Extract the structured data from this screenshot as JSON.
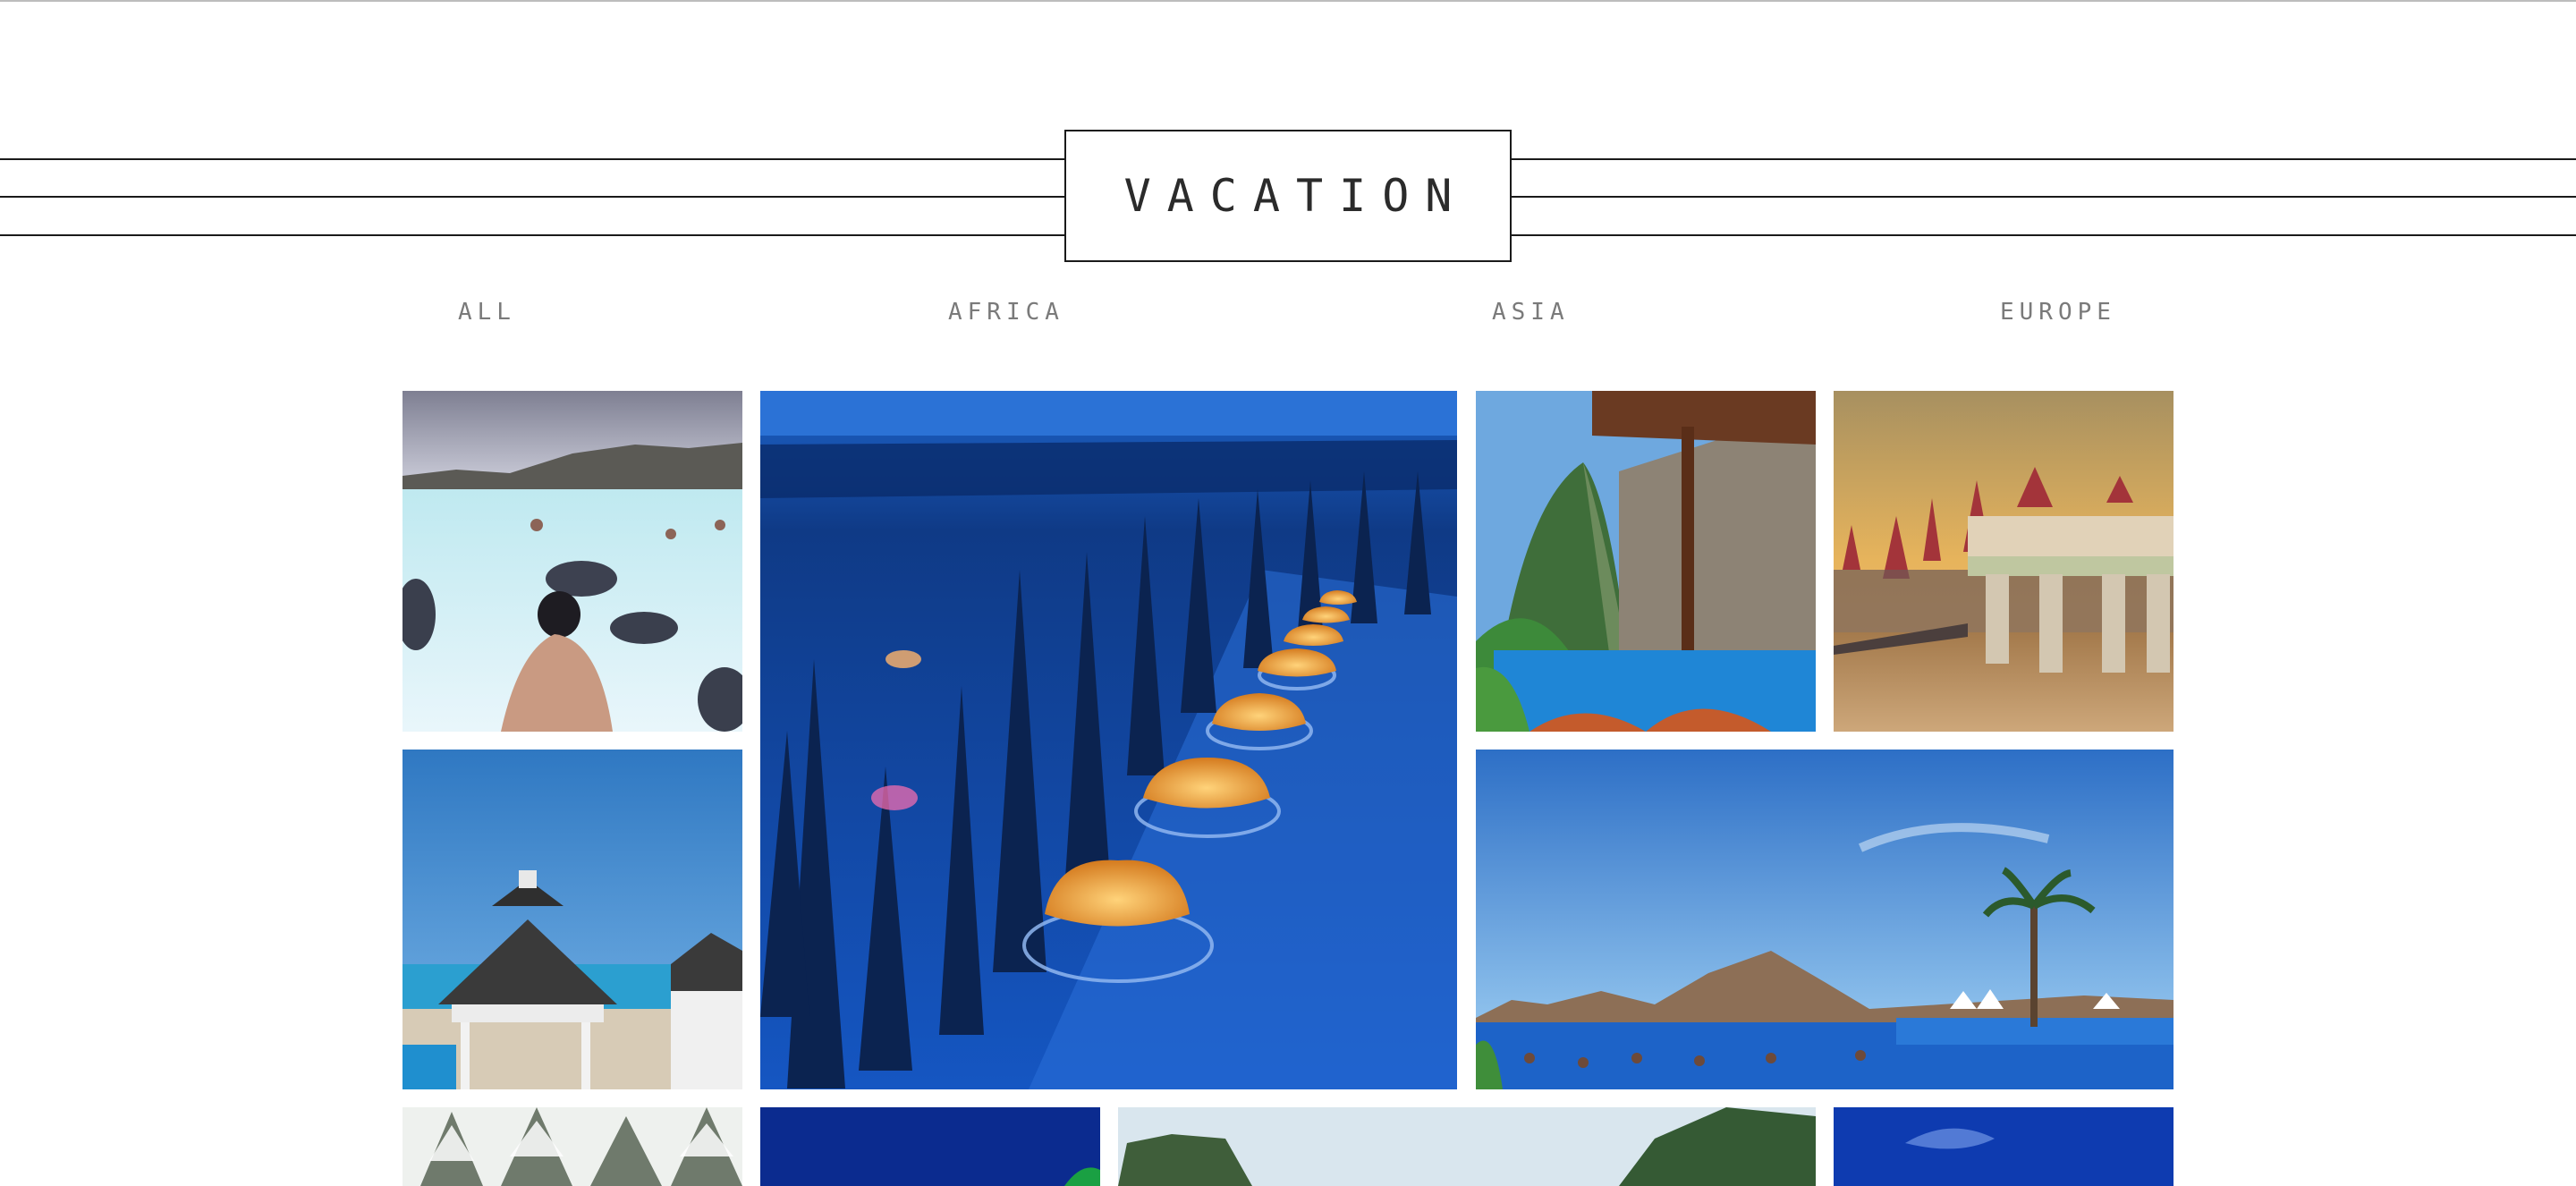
{
  "header": {
    "title": "VACATION"
  },
  "nav": {
    "items": [
      "ALL",
      "AFRICA",
      "ASIA",
      "EUROPE"
    ]
  },
  "gallery": {
    "tiles": [
      "blue-lagoon-iceland",
      "glass-igloos-snow-forest",
      "caribbean-pitons-resort-pool",
      "castle-bridge-sunset",
      "beach-gazebo-resort",
      "infinity-pool-mountain-bay",
      "snowy-pines",
      "night-blue-scene",
      "rocky-island-lagoon",
      "deep-blue-sky"
    ]
  }
}
